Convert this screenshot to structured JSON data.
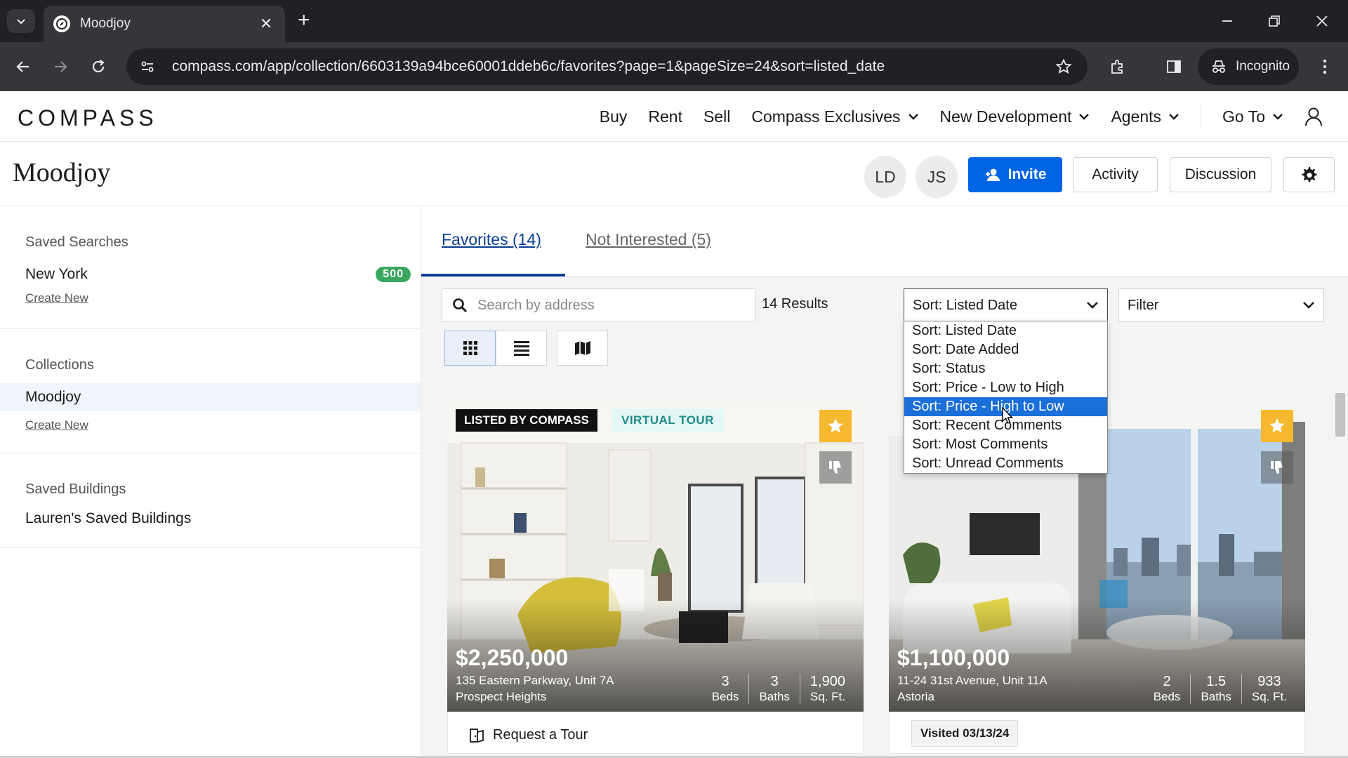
{
  "browser": {
    "tab_title": "Moodjoy",
    "url": "compass.com/app/collection/6603139a94bce60001ddeb6c/favorites?page=1&pageSize=24&sort=listed_date",
    "incognito_label": "Incognito"
  },
  "site": {
    "logo": "COMPASS",
    "nav": {
      "buy": "Buy",
      "rent": "Rent",
      "sell": "Sell",
      "exclusives": "Compass Exclusives",
      "new_dev": "New Development",
      "agents": "Agents",
      "goto": "Go To"
    }
  },
  "collection": {
    "title": "Moodjoy",
    "avatars": [
      "LD",
      "JS"
    ],
    "invite_label": "Invite",
    "activity_label": "Activity",
    "discussion_label": "Discussion"
  },
  "sidebar": {
    "saved_searches": {
      "heading": "Saved Searches",
      "items": [
        {
          "label": "New York",
          "count": "500"
        }
      ],
      "create_new": "Create New"
    },
    "collections": {
      "heading": "Collections",
      "items": [
        {
          "label": "Moodjoy"
        }
      ],
      "create_new": "Create New"
    },
    "saved_buildings": {
      "heading": "Saved Buildings",
      "items": [
        {
          "label": "Lauren's Saved Buildings"
        }
      ]
    }
  },
  "main": {
    "tabs": [
      {
        "label": "Favorites (14)",
        "active": true
      },
      {
        "label": "Not Interested (5)",
        "active": false
      }
    ],
    "search_placeholder": "Search by address",
    "results_label": "14 Results",
    "sort_value": "Sort: Listed Date",
    "filter_label": "Filter",
    "sort_options": [
      "Sort: Listed Date",
      "Sort: Date Added",
      "Sort: Status",
      "Sort: Price - Low to High",
      "Sort: Price - High to Low",
      "Sort: Recent Comments",
      "Sort: Most Comments",
      "Sort: Unread Comments"
    ],
    "highlighted_option_index": 4
  },
  "listings": [
    {
      "tag_primary": "LISTED BY COMPASS",
      "tag_secondary": "VIRTUAL TOUR",
      "price": "$2,250,000",
      "address": "135 Eastern Parkway, Unit 7A",
      "neighborhood": "Prospect Heights",
      "beds": "3",
      "beds_label": "Beds",
      "baths": "3",
      "baths_label": "Baths",
      "sqft": "1,900",
      "sqft_label": "Sq. Ft.",
      "footer_action": "Request a Tour"
    },
    {
      "price": "$1,100,000",
      "address": "11-24 31st Avenue, Unit 11A",
      "neighborhood": "Astoria",
      "beds": "2",
      "beds_label": "Beds",
      "baths": "1.5",
      "baths_label": "Baths",
      "sqft": "933",
      "sqft_label": "Sq. Ft.",
      "footer_badge": "Visited 03/13/24"
    }
  ],
  "colors": {
    "accent_blue": "#0064e5",
    "favorites_tab": "#0b3d91",
    "badge_green": "#3aa760",
    "favorite_star": "#f5b82e",
    "dropdown_highlight": "#1a6fd9"
  },
  "icons": [
    "chevron-down-icon",
    "compass-favicon-icon",
    "close-icon",
    "plus-icon",
    "back-arrow-icon",
    "forward-arrow-icon",
    "reload-icon",
    "site-info-icon",
    "bookmark-star-icon",
    "extensions-icon",
    "side-panel-icon",
    "incognito-icon",
    "more-vert-icon",
    "user-icon",
    "add-person-icon",
    "gear-icon",
    "search-icon",
    "grid-view-icon",
    "list-view-icon",
    "map-view-icon",
    "star-icon",
    "thumbs-down-icon",
    "tour-icon"
  ]
}
